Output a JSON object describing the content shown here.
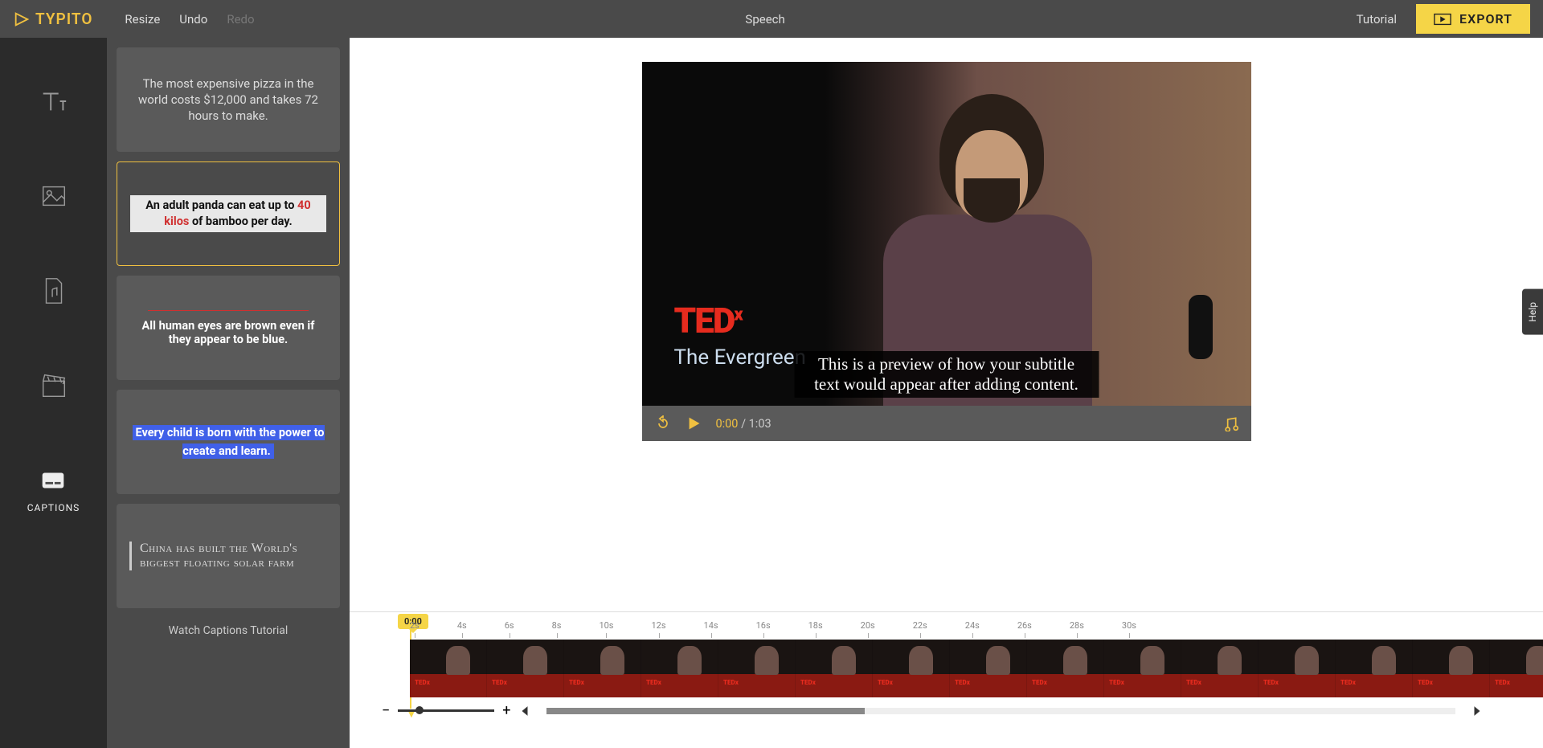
{
  "brand": "TYPITO",
  "topbar": {
    "resize": "Resize",
    "undo": "Undo",
    "redo": "Redo",
    "center": "Speech",
    "tutorial": "Tutorial",
    "export": "EXPORT"
  },
  "rail": {
    "captions": "CAPTIONS"
  },
  "caption_cards": {
    "c1": "The most expensive pizza in the world costs $12,000 and takes 72 hours to make.",
    "c2_pre": "An adult panda can eat up to ",
    "c2_hl1": "40",
    "c2_mid": " ",
    "c2_hl2": "kilos",
    "c2_post": " of bamboo per day.",
    "c3": "All human eyes are brown even if they appear to be blue.",
    "c4": "Every child is born with the power to create and learn.",
    "c5": "China has built the World's biggest floating solar farm"
  },
  "sidebar_footer": "Watch Captions Tutorial",
  "preview": {
    "ted": "TED",
    "ted_x": "x",
    "ted_sub": "The Evergreen",
    "subtitle": "This is a preview of how your subtitle text would appear after adding content."
  },
  "player": {
    "current": "0:00",
    "sep": " / ",
    "duration": "1:03"
  },
  "timeline": {
    "playhead": "0:00",
    "ticks": [
      "2s",
      "4s",
      "6s",
      "8s",
      "10s",
      "12s",
      "14s",
      "16s",
      "18s",
      "20s",
      "22s",
      "24s",
      "26s",
      "28s",
      "30s"
    ]
  },
  "help": "Help"
}
